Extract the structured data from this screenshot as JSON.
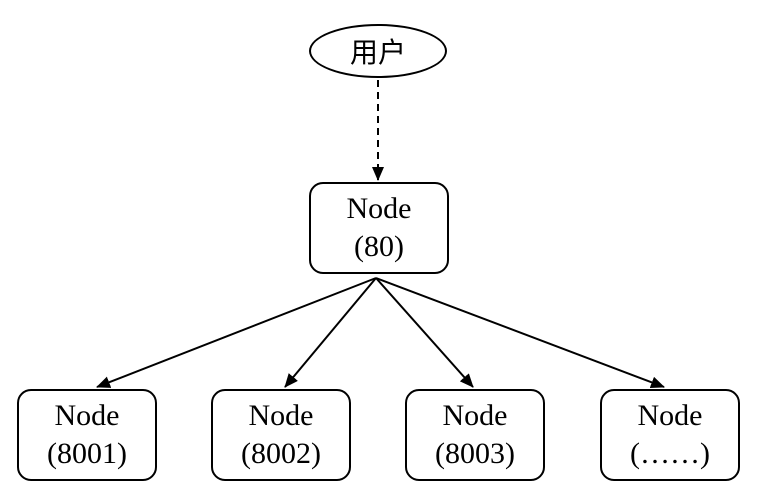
{
  "user": {
    "label": "用户"
  },
  "root": {
    "line1": "Node",
    "line2": "(80)"
  },
  "children": [
    {
      "line1": "Node",
      "line2": "(8001)"
    },
    {
      "line1": "Node",
      "line2": "(8002)"
    },
    {
      "line1": "Node",
      "line2": "(8003)"
    },
    {
      "line1": "Node",
      "line2": "(……)"
    }
  ],
  "colors": {
    "stroke": "#000000",
    "background": "#ffffff"
  }
}
